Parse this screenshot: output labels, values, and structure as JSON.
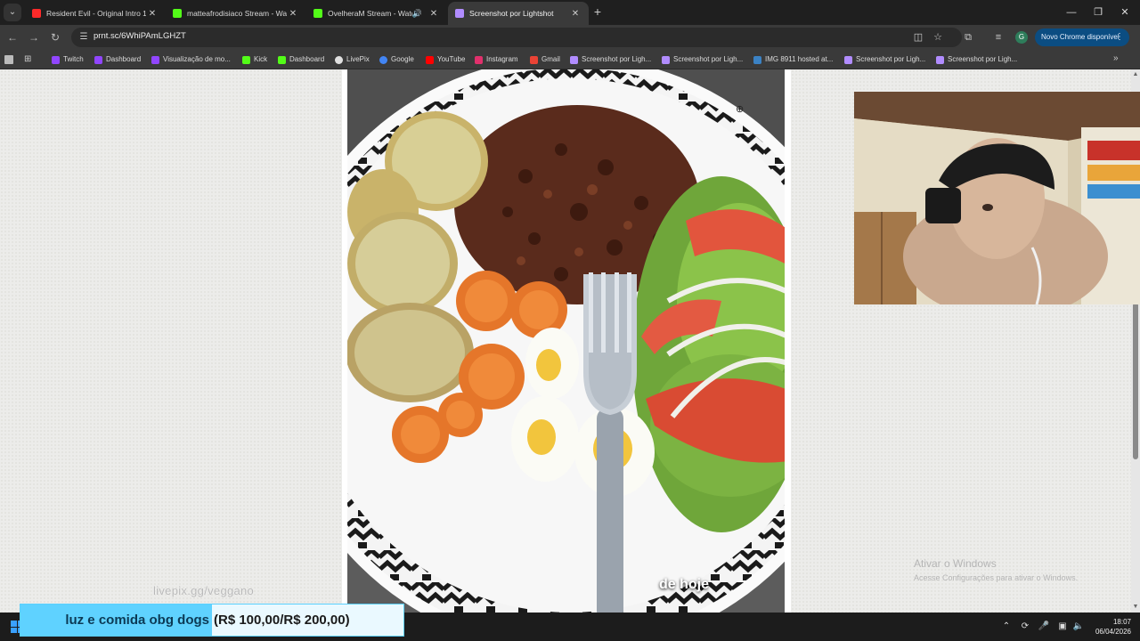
{
  "browser": {
    "tabs": [
      {
        "title": "Resident Evil - Original Intro 19",
        "favicon_color": "#ff2a2a",
        "has_close": true
      },
      {
        "title": "matteafrodisiaco Stream - Watc",
        "favicon_color": "#53fc18",
        "has_close": true
      },
      {
        "title": "OvelheraM Stream - Watch",
        "favicon_color": "#53fc18",
        "has_close": true
      },
      {
        "title": "Screenshot por Lightshot",
        "favicon_color": "#b18cff",
        "has_close": true
      }
    ],
    "address": {
      "url": "prnt.sc/6WhiPAmLGHZT"
    },
    "update_button": "Novo Chrome disponível",
    "profile_initial": "G",
    "bookmarks": [
      {
        "label": "Twitch",
        "color": "#9146ff"
      },
      {
        "label": "Dashboard",
        "color": "#9146ff"
      },
      {
        "label": "Visualização de mo...",
        "color": "#9146ff"
      },
      {
        "label": "Kick",
        "color": "#53fc18"
      },
      {
        "label": "Dashboard",
        "color": "#53fc18"
      },
      {
        "label": "LivePix",
        "color": "#e0e0e0"
      },
      {
        "label": "Google",
        "color": "#4285f4"
      },
      {
        "label": "YouTube",
        "color": "#ff0000"
      },
      {
        "label": "Instagram",
        "color": "#e1306c"
      },
      {
        "label": "Gmail",
        "color": "#ea4335"
      },
      {
        "label": "Screenshot por Ligh...",
        "color": "#b18cff"
      },
      {
        "label": "Screenshot por Ligh...",
        "color": "#b18cff"
      },
      {
        "label": "IMG 8911 hosted at...",
        "color": "#3b82c4"
      },
      {
        "label": "Screenshot por Ligh...",
        "color": "#b18cff"
      },
      {
        "label": "Screenshot por Ligh...",
        "color": "#b18cff"
      }
    ]
  },
  "content": {
    "image_caption": "de hoje",
    "watermark": "livepix.gg/veggano"
  },
  "overlay": {
    "windows_activation_title": "Ativar o Windows",
    "windows_activation_sub": "Acesse Configurações para ativar o Windows.",
    "donation_message": "luz e comida obg dogs",
    "donation_progress_text": "(R$ 100,00/R$ 200,00)",
    "donation_progress_fraction": 0.5
  },
  "taskbar": {
    "time": "18:07",
    "date": "06/04/2026"
  },
  "colors": {
    "accent_blue": "#5fd2ff",
    "chrome_dark": "#1f1f1f",
    "chrome_toolbar": "#3a3a3a"
  }
}
